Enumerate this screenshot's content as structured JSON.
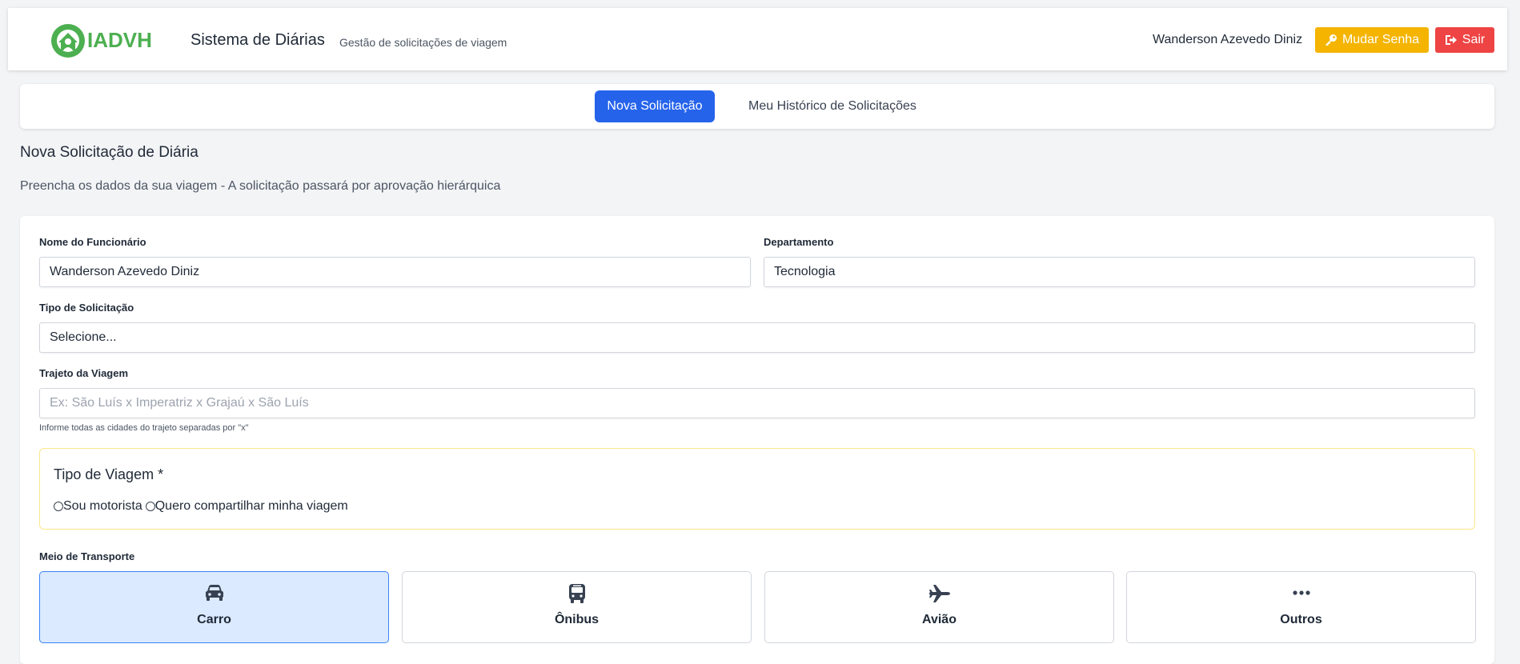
{
  "header": {
    "logo_text": "IADVH",
    "title": "Sistema de Diárias",
    "subtitle": "Gestão de solicitações de viagem",
    "user_name": "Wanderson Azevedo Diniz",
    "change_password_label": "Mudar Senha",
    "logout_label": "Sair"
  },
  "tabs": {
    "new_request": "Nova Solicitação",
    "history": "Meu Histórico de Solicitações"
  },
  "page": {
    "title": "Nova Solicitação de Diária",
    "description": "Preencha os dados da sua viagem - A solicitação passará por aprovação hierárquica"
  },
  "form": {
    "employee_label": "Nome do Funcionário",
    "employee_value": "Wanderson Azevedo Diniz",
    "department_label": "Departamento",
    "department_value": "Tecnologia",
    "request_type_label": "Tipo de Solicitação",
    "request_type_value": "Selecione...",
    "route_label": "Trajeto da Viagem",
    "route_placeholder": "Ex: São Luís x Imperatriz x Grajaú x São Luís",
    "route_hint": "Informe todas as cidades do trajeto separadas por \"x\"",
    "trip_type_title": "Tipo de Viagem *",
    "trip_type_options": [
      "Sou motorista",
      "Quero compartilhar minha viagem"
    ],
    "transport_label": "Meio de Transporte",
    "transport_options": [
      {
        "label": "Carro",
        "icon": "car-icon",
        "selected": true
      },
      {
        "label": "Ônibus",
        "icon": "bus-icon",
        "selected": false
      },
      {
        "label": "Avião",
        "icon": "plane-icon",
        "selected": false
      },
      {
        "label": "Outros",
        "icon": "ellipsis-icon",
        "selected": false
      }
    ]
  },
  "colors": {
    "primary": "#2563eb",
    "warning": "#f4b400",
    "danger": "#ef4444",
    "logo_green": "#4caf50",
    "selected_bg": "#dbeafe"
  }
}
